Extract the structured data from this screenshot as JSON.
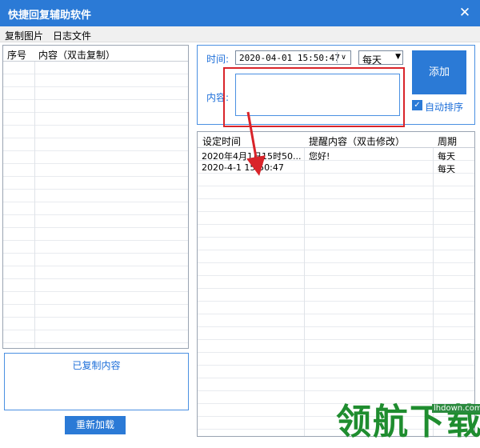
{
  "window": {
    "title": "快捷回复辅助软件",
    "close_glyph": "✕"
  },
  "menu": {
    "items": [
      "复制图片",
      "日志文件"
    ]
  },
  "left_table": {
    "columns": [
      "序号",
      "内容（双击复制）"
    ]
  },
  "copied_panel": {
    "label": "已复制内容"
  },
  "reload_button": {
    "label": "重新加载"
  },
  "form": {
    "time_label": "时间:",
    "time_value": "2020-04-01 15:50:47",
    "cycle_value": "每天",
    "add_label": "添加",
    "content_label": "内容:",
    "content_value": "",
    "auto_sort_label": "自动排序",
    "auto_sort_checked": true
  },
  "reminder_table": {
    "columns": [
      "设定时间",
      "提醒内容（双击修改）",
      "周期"
    ],
    "rows": [
      {
        "time": "2020年4月1日15时50...",
        "content": "您好!",
        "cycle": "每天"
      },
      {
        "time": "2020-4-1 15:50:47",
        "content": "",
        "cycle": "每天"
      }
    ]
  },
  "watermark": {
    "text": "领航下载",
    "url": "lhdown.com"
  },
  "colors": {
    "accent": "#2b7ad6",
    "highlight": "#d9242a",
    "watermark": "#1f8d2f"
  }
}
